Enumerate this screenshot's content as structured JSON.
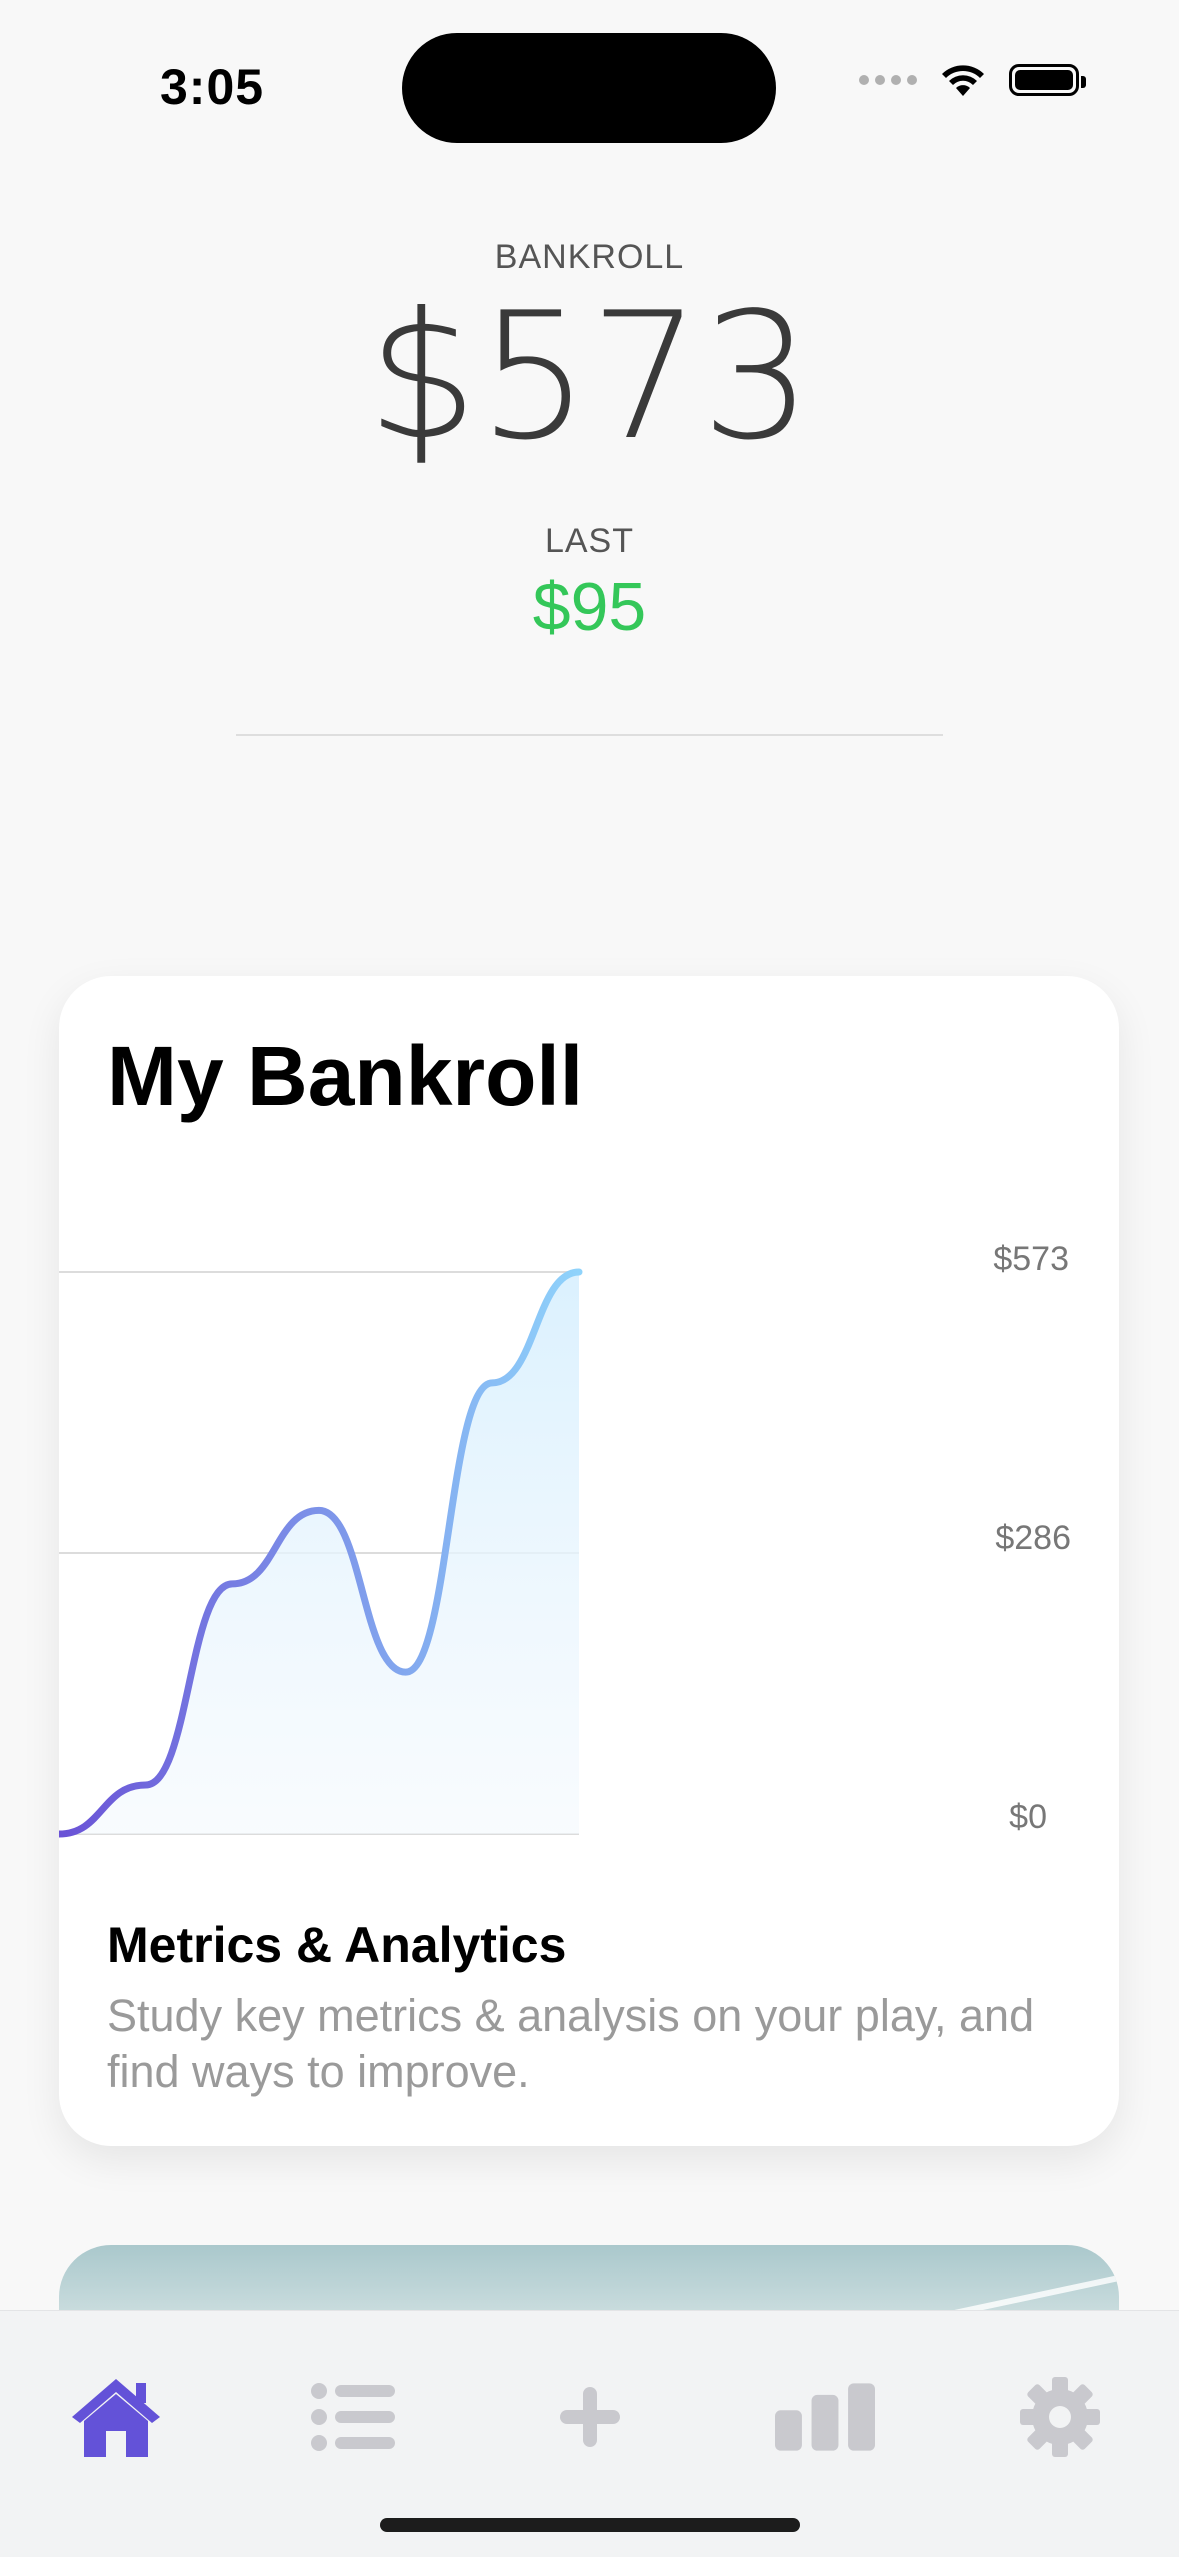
{
  "status_bar": {
    "time": "3:05"
  },
  "header": {
    "bankroll_label": "BANKROLL",
    "bankroll_amount": "$573",
    "last_label": "LAST",
    "last_amount": "$95",
    "last_color": "#34c759"
  },
  "card": {
    "title": "My Bankroll",
    "metrics_title": "Metrics & Analytics",
    "metrics_description": "Study key metrics & analysis on your play, and find ways to improve."
  },
  "chart_data": {
    "type": "area",
    "title": "My Bankroll",
    "xlabel": "",
    "ylabel": "",
    "y_ticks": [
      "$573",
      "$286",
      "$0"
    ],
    "ylim": [
      0,
      573
    ],
    "series": [
      {
        "values": [
          0,
          50,
          255,
          330,
          165,
          460,
          573
        ]
      }
    ],
    "grid": true,
    "line_gradient": [
      "#6a52d6",
      "#8fd3fb"
    ],
    "fill_color": "#dff2fd"
  },
  "tab_bar": {
    "active_color": "#6352d8",
    "inactive_color": "#c9c9ce",
    "items": [
      "home",
      "list",
      "add",
      "stats",
      "settings"
    ]
  }
}
